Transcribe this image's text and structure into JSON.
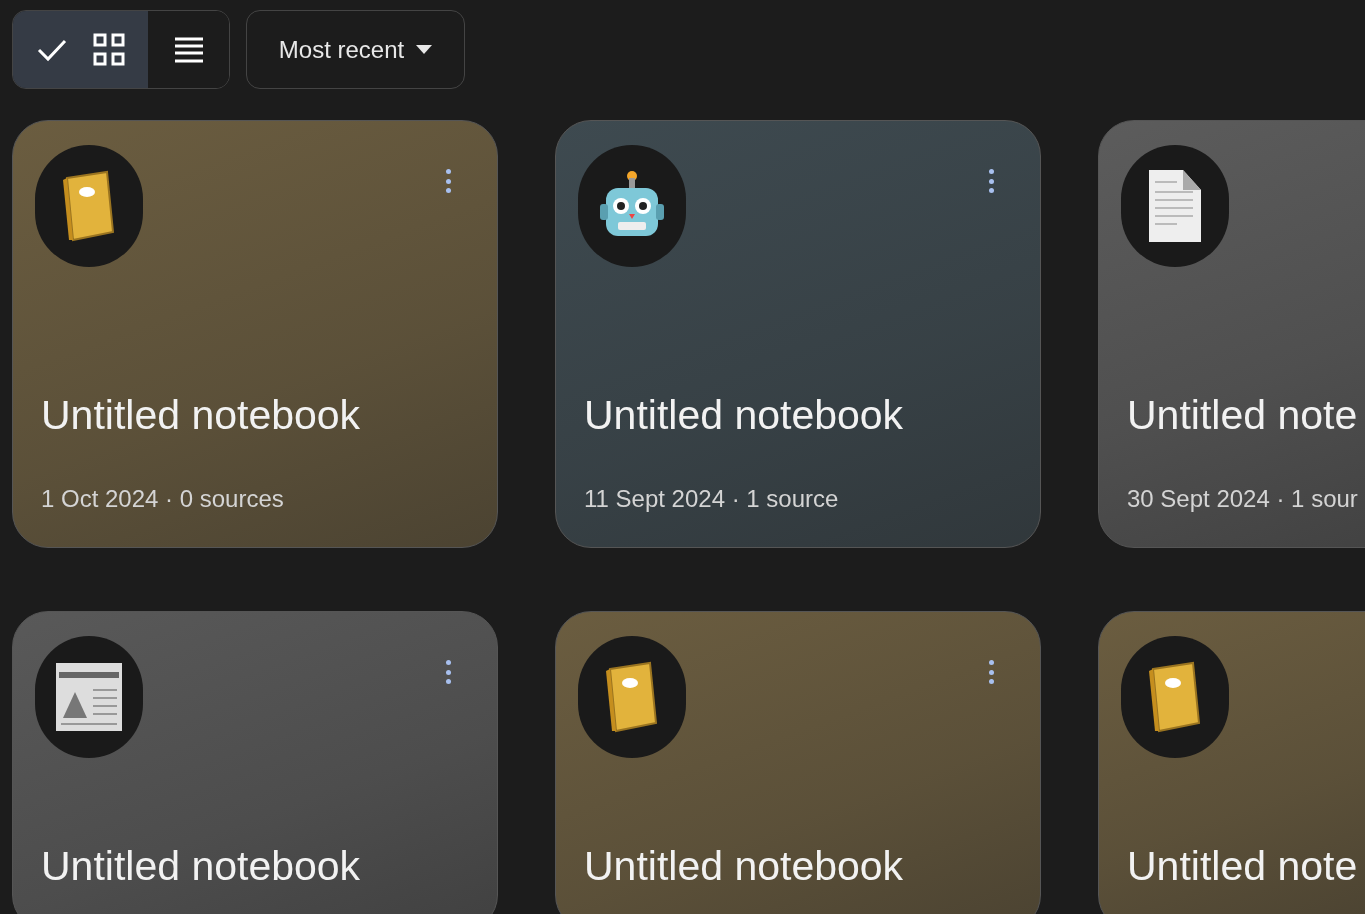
{
  "toolbar": {
    "view_toggle": [
      {
        "kind": "grid",
        "selected": true
      },
      {
        "kind": "list",
        "selected": false
      }
    ],
    "sort": {
      "label": "Most recent"
    }
  },
  "notebooks": [
    {
      "kind": "notebook",
      "color": "#6b5d40",
      "title": "Untitled notebook",
      "meta": "1 Oct 2024 · 0 sources",
      "menu": true
    },
    {
      "kind": "robot",
      "color": "#3e4a50",
      "title": "Untitled notebook",
      "meta": "11 Sept 2024 · 1 source",
      "menu": true
    },
    {
      "kind": "document",
      "color": "#5c5c5c",
      "title": "Untitled note",
      "meta": "30 Sept 2024 · 1 sour",
      "menu": false
    },
    {
      "kind": "newspaper",
      "color": "#595959",
      "title": "Untitled notebook",
      "menu": true
    },
    {
      "kind": "notebook",
      "color": "#6b5d40",
      "title": "Untitled notebook",
      "menu": true
    },
    {
      "kind": "notebook",
      "color": "#6b5d40",
      "title": "Untitled note",
      "menu": false
    }
  ]
}
